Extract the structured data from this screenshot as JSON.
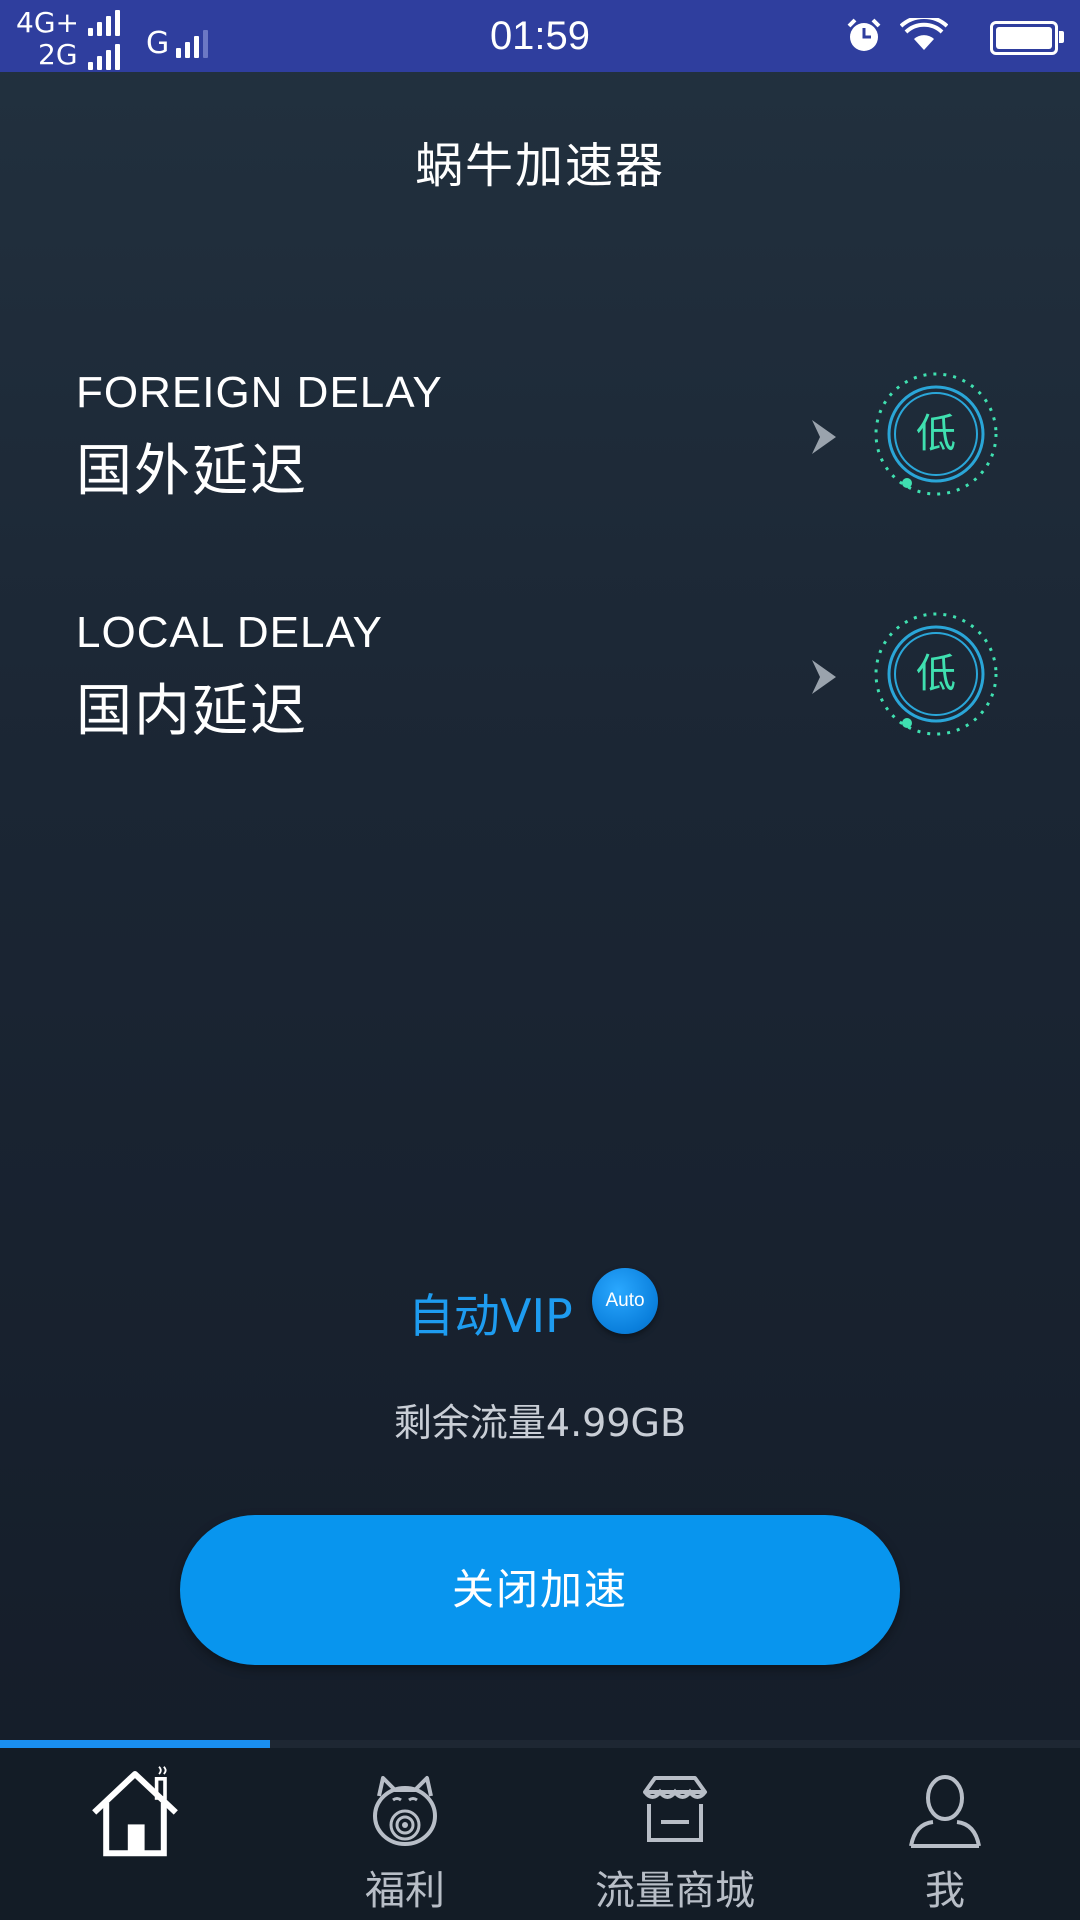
{
  "status_bar": {
    "network1": "4G+",
    "network2": "2G",
    "network3": "G",
    "time": "01:59"
  },
  "header": {
    "title": "蜗牛加速器"
  },
  "delays": {
    "foreign": {
      "label_en": "FOREIGN DELAY",
      "label_zh": "国外延迟",
      "level": "低"
    },
    "local": {
      "label_en": "LOCAL DELAY",
      "label_zh": "国内延迟",
      "level": "低"
    }
  },
  "vip": {
    "label": "自动VIP",
    "badge": "Auto"
  },
  "traffic": {
    "remaining": "剩余流量4.99GB"
  },
  "main_button": {
    "label": "关闭加速"
  },
  "tabs": [
    {
      "label": "",
      "icon": "home-icon"
    },
    {
      "label": "福利",
      "icon": "lucky-cat-icon"
    },
    {
      "label": "流量商城",
      "icon": "shop-icon"
    },
    {
      "label": "我",
      "icon": "user-icon"
    }
  ],
  "colors": {
    "status_bar": "#2f3e9e",
    "accent": "#0895ee",
    "gauge": "#3fe0b0",
    "vip_text": "#1e9cf0"
  }
}
